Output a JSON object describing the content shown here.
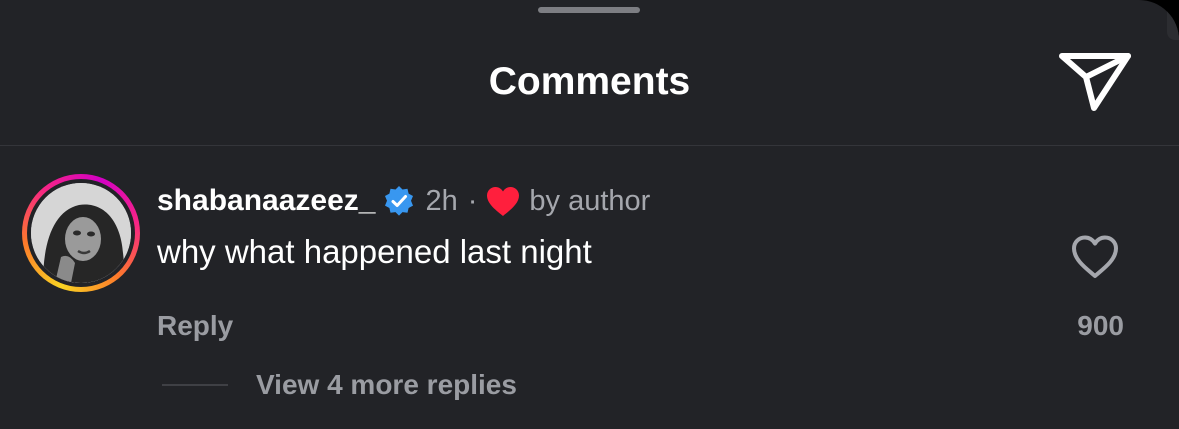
{
  "header": {
    "title": "Comments",
    "share_icon": "send-icon"
  },
  "comment": {
    "username": "shabanaazeez_",
    "verified": true,
    "timestamp": "2h",
    "separator": "·",
    "liked_by_author_icon": "heart-filled-icon",
    "liked_by_author_text": "by author",
    "text": "why what happened last night",
    "like_icon": "heart-outline-icon",
    "like_count": "900",
    "reply_label": "Reply",
    "view_replies_label": "View 4 more replies"
  },
  "colors": {
    "background": "#222327",
    "text_primary": "#ffffff",
    "text_secondary": "#9a9ca2",
    "verified_blue": "#3897f0",
    "heart_red": "#ff1f3d"
  }
}
